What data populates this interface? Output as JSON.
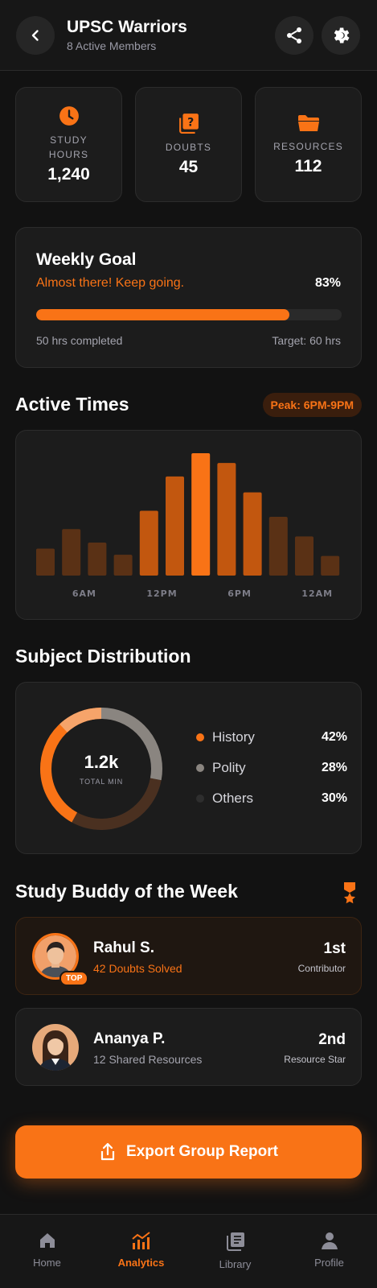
{
  "header": {
    "title": "UPSC Warriors",
    "subtitle": "8 Active Members",
    "back_icon": "chevron-left-icon",
    "share_icon": "share-icon",
    "settings_icon": "gear-icon"
  },
  "stats": [
    {
      "label": "STUDY HOURS",
      "value": "1,240",
      "icon": "clock-icon"
    },
    {
      "label": "DOUBTS",
      "value": "45",
      "icon": "question-icon"
    },
    {
      "label": "RESOURCES",
      "value": "112",
      "icon": "folder-icon"
    }
  ],
  "weekly_goal": {
    "title": "Weekly Goal",
    "message": "Almost there! Keep going.",
    "percent_label": "83%",
    "progress": 0.83,
    "completed": "50 hrs completed",
    "target": "Target: 60 hrs"
  },
  "active_times": {
    "title": "Active Times",
    "peak": "Peak: 6PM-9PM",
    "tick_labels": [
      "6AM",
      "12PM",
      "6PM",
      "12AM"
    ]
  },
  "subject_distribution": {
    "title": "Subject Distribution",
    "center_value": "1.2k",
    "center_label": "TOTAL MIN",
    "legend": [
      {
        "name": "History",
        "value": "42%",
        "color": "#f97316"
      },
      {
        "name": "Polity",
        "value": "28%",
        "color": "#8a8580"
      },
      {
        "name": "Others",
        "value": "30%",
        "color": "#3a2a1e"
      }
    ]
  },
  "chart_data": [
    {
      "type": "bar",
      "categories": [
        "",
        "",
        "",
        "6AM",
        "",
        "",
        "12PM",
        "",
        "",
        "6PM",
        "",
        "",
        "12AM",
        ""
      ],
      "values": [
        22,
        38,
        27,
        17,
        53,
        81,
        100,
        92,
        68,
        48,
        32,
        16
      ],
      "highlight_index": 6,
      "ylim": [
        0,
        100
      ],
      "grid": false
    },
    {
      "type": "pie",
      "labels": [
        "History",
        "Polity",
        "Others"
      ],
      "values": [
        42,
        28,
        30
      ]
    }
  ],
  "study_buddy": {
    "title": "Study Buddy of the Week",
    "award_icon": "medal-icon",
    "buddies": [
      {
        "name": "Rahul S.",
        "detail": "42 Doubts Solved",
        "rank": "1st",
        "role": "Contributor",
        "badge": "TOP"
      },
      {
        "name": "Ananya P.",
        "detail": "12 Shared Resources",
        "rank": "2nd",
        "role": "Resource Star"
      }
    ]
  },
  "export_button": {
    "label": "Export Group Report",
    "icon": "export-icon"
  },
  "nav": [
    {
      "label": "Home",
      "icon": "home-icon"
    },
    {
      "label": "Analytics",
      "icon": "analytics-icon",
      "active": true
    },
    {
      "label": "Library",
      "icon": "library-icon"
    },
    {
      "label": "Profile",
      "icon": "profile-icon"
    }
  ],
  "colors": {
    "accent": "#f97316",
    "background": "#121212",
    "card": "#1c1c1c"
  }
}
